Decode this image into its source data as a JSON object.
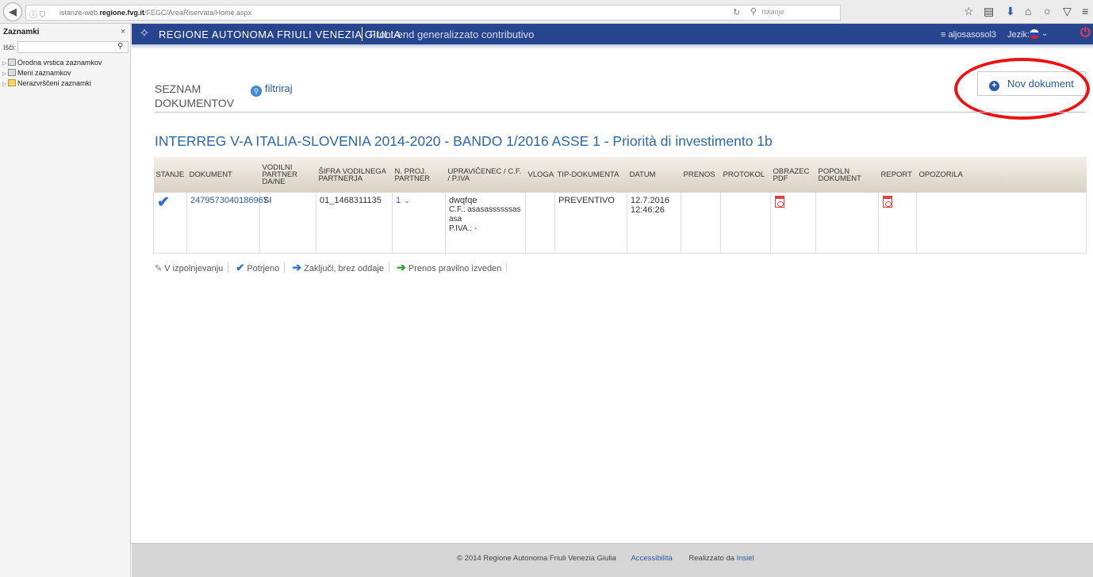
{
  "browser": {
    "url_prefix": "istanze-web.",
    "url_domain": "regione.fvg.it",
    "url_path": "/FEGC/AreaRiservata/Home.aspx",
    "search_placeholder": "Iskanje"
  },
  "sidebar": {
    "title": "Zaznamki",
    "search_label": "Išči:",
    "items": [
      {
        "label": "Orodna vrstica zaznamkov"
      },
      {
        "label": "Meni zaznamkov"
      },
      {
        "label": "Nerazvrščeni zaznamki"
      }
    ]
  },
  "header": {
    "region_title": "REGIONE AUTONOMA FRIULI VENEZIA GIULIA",
    "app_subtitle": "Front-end generalizzato contributivo",
    "user": "≡ aljosasosol3",
    "language_label": "Jezik:"
  },
  "page": {
    "title": "SEZNAM DOKUMENTOV",
    "filter_label": "filtriraj",
    "new_document_label": "Nov dokument",
    "program_title": "INTERREG V-A ITALIA-SLOVENIA 2014-2020 - BANDO 1/2016 ASSE 1 - Priorità di investimento 1b"
  },
  "table": {
    "columns": [
      "STANJE",
      "DOKUMENT",
      "VODILNI PARTNER DA/NE",
      "ŠIFRA VODILNEGA PARTNERJA",
      "N. PROJ. PARTNER",
      "UPRAVIČENEC / C.F. / P.IVA",
      "VLOGA",
      "TIP-DOKUMENTA",
      "DATUM",
      "PRENOS",
      "PROTOKOL",
      "OBRAZEC PDF",
      "POPOLN DOKUMENT",
      "REPORT",
      "OPOZORILA"
    ],
    "rows": [
      {
        "status_icon": "check-icon",
        "document": "2479573040186967",
        "lead_partner": "SI",
        "lead_partner_code": "01_1468311135",
        "project_partners": "1",
        "beneficiary_name": "dwqfqe",
        "beneficiary_cf": "C.F.: asasassssssasasa",
        "beneficiary_piva": "P.IVA.: -",
        "role": "",
        "doc_type": "PREVENTIVO",
        "date": "12.7.2016",
        "time": "12:46:26",
        "transfer": "",
        "protocol": "",
        "form_pdf_icon": "pdf-icon",
        "complete_document": "",
        "report_icon": "pdf-icon",
        "warnings": ""
      }
    ]
  },
  "legend": {
    "in_progress": "V izpolnjevanju",
    "confirmed": "Potrjeno",
    "closed_not_submitted": "Zaključi, brez oddaje",
    "transfer_ok": "Prenos pravilno izveden"
  },
  "footer": {
    "copyright": "© 2014 Regione Autonoma Friuli Venezia Giulia",
    "accessibility": "Accessibilità",
    "made_by": "Realizzato da",
    "made_by_link": "Insiel"
  },
  "colors": {
    "header_bg": "#27448f",
    "link": "#2b5aa8",
    "title": "#2a68a9",
    "highlight": "#ee1111"
  }
}
